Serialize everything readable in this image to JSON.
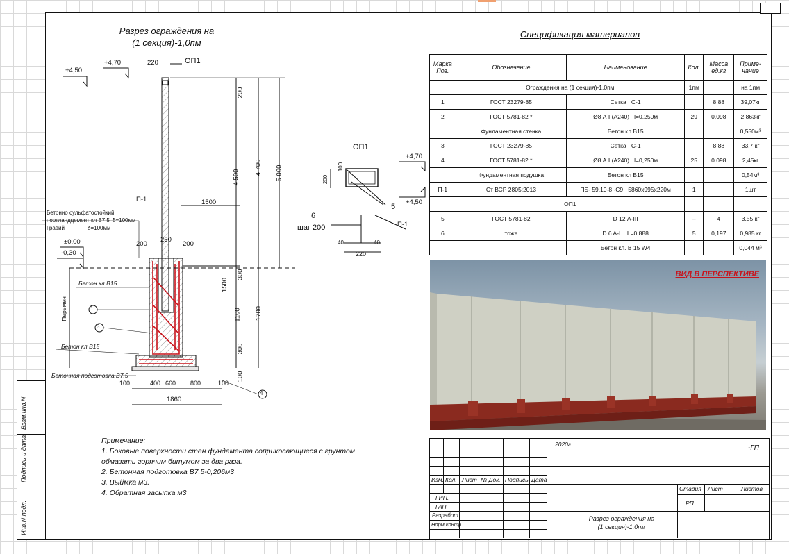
{
  "drawing": {
    "section_title_line1": "Разрез ограждения на",
    "section_title_line2": "(1 секция)-1,0пм",
    "spec_title": "Спецификация материалов",
    "perspective_label": "ВИД   В ПЕРСПЕКТИВЕ",
    "elevations": [
      "+4,50",
      "+4,70",
      "±0,00",
      "-0,30",
      "+4,70",
      "+4,50"
    ],
    "dims": [
      "220",
      "200",
      "4 500",
      "4 700",
      "5 000",
      "1500",
      "200",
      "250",
      "200",
      "1500",
      "300",
      "1100",
      "1700",
      "300",
      "100",
      "100",
      "400",
      "660",
      "800",
      "100",
      "1860",
      "200",
      "100",
      "40",
      "220",
      "40"
    ],
    "labels": {
      "op1": "ОП1",
      "op1_detail": "ОП1",
      "p1": "П-1",
      "p1_detail": "П-1",
      "beton_sulf": "Бетонно сульфатостойкий",
      "portland": "портландцемент кл В7.5",
      "portland_thk": "δ=100мм",
      "gravel": "Гравий",
      "gravel_thk": "δ=100мм",
      "beton_b15_upper": "Бетон кл B15",
      "beton_b15_lower": "Бетон кл B15",
      "beton_prep": "Бетонная подготовка  B7.5",
      "peremen": "Перемен",
      "six": "6",
      "step": "шаг 200",
      "five": "5"
    },
    "callouts": [
      "1",
      "2",
      "3",
      "4"
    ]
  },
  "spec_table": {
    "headers": [
      "Марка Поз.",
      "Обозначение",
      "Наименование",
      "Кол.",
      "Масса ед.кг",
      "Приме-чание"
    ],
    "rows": [
      {
        "type": "section",
        "text": "Ограждения на (1 секция)-1,0пм",
        "qty": "1пм",
        "note": "на 1пм"
      },
      {
        "mark": "1",
        "doc": "ГОСТ 23279-85",
        "name": "Сетка",
        "name2": "С-1",
        "qty": "",
        "mass": "8.88",
        "note": "39,07кг"
      },
      {
        "mark": "2",
        "doc": "ГОСТ 5781-82 *",
        "name": "Ø8 А I  (А240)",
        "name2": "l=0,250м",
        "qty": "29",
        "mass": "0.098",
        "note": "2,863кг"
      },
      {
        "type": "sub",
        "doc": "Фундаментная стенка",
        "name": "Бетон кл B15",
        "note": "0,550м³"
      },
      {
        "mark": "3",
        "doc": "ГОСТ 23279-85",
        "name": "Сетка",
        "name2": "С-1",
        "qty": "",
        "mass": "8.88",
        "note": "33,7 кг"
      },
      {
        "mark": "4",
        "doc": "ГОСТ 5781-82 *",
        "name": "Ø8 А I  (А240)",
        "name2": "l=0,250м",
        "qty": "25",
        "mass": "0.098",
        "note": "2,45кг"
      },
      {
        "type": "sub",
        "doc": "Фундаментная подушка",
        "name": "Бетон кл B15",
        "note": "0,54м³"
      },
      {
        "mark": "П-1",
        "doc": "Ст ВСР 2805:2013",
        "name": "ПБ- 59.10-8 -С9",
        "name2": "5860х995х220м",
        "qty": "1",
        "mass": "",
        "note": "1шт"
      },
      {
        "type": "section",
        "text": "ОП1",
        "qty": "",
        "note": ""
      },
      {
        "mark": "5",
        "doc": "ГОСТ 5781-82",
        "name": "D 12 А-III",
        "name2": "",
        "qty": "–",
        "mass": "4",
        "note": "3,55 кг"
      },
      {
        "mark": "6",
        "doc": "тоже",
        "name": "D 6 A-I",
        "name2": "L=0,888",
        "qty": "5",
        "mass": "0,197",
        "note": "0,985 кг"
      },
      {
        "mark": "",
        "doc": "",
        "name": "Бетон кл. В 15 W4",
        "name2": "",
        "qty": "",
        "mass": "",
        "note": "0,044 м³"
      }
    ]
  },
  "notes": {
    "heading": "Примечание:",
    "line1": "1. Боковые поверхности стен фундамента соприкосающиеся с грунтом",
    "line1b": "обмазать горячим битумом за два раза.",
    "line2": "2.    Бетонная подготовка  В7.5-0,206м3",
    "line3": "3. Выймка       м3.",
    "line4": "4. Обратная засыпка         м3"
  },
  "stamp": {
    "year": "2020г",
    "code": "-ГП",
    "cols": [
      "Изм.",
      "Кол.",
      "Лист",
      "№ Док.",
      "Подпись",
      "Дата"
    ],
    "rows": [
      "ГИП.",
      "ГАП.",
      "Разработ",
      "Норм контр"
    ],
    "stage_h": "Стадия",
    "sheet_h": "Лист",
    "sheets_h": "Листов",
    "stage": "РП",
    "title_line1": "Разрез ограждения на",
    "title_line2": "(1 секция)-1,0пм"
  },
  "side": {
    "cell1": "Взам.инв.N",
    "cell2": "Подпись и дата",
    "cell3": "Инв.N подл."
  },
  "colors": {
    "rebar": "#c8141c",
    "wall": "#8a2a1f",
    "panel": "#cfd0c4",
    "accent": "#c8141c"
  }
}
